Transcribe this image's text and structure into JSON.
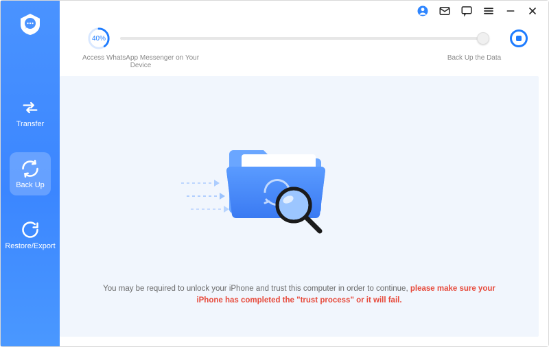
{
  "sidebar": {
    "items": [
      {
        "label": "Transfer"
      },
      {
        "label": "Back Up"
      },
      {
        "label": "Restore/Export"
      }
    ]
  },
  "progress": {
    "percent_label": "40%",
    "percent_value": 40,
    "step1_label": "Access WhatsApp Messenger on Your Device",
    "step2_label": "Back Up the Data"
  },
  "message": {
    "prefix": "You may be required to unlock your iPhone and trust this computer in order to continue, ",
    "warning": "please make sure your iPhone has completed the \"trust process\" or it will fail."
  }
}
